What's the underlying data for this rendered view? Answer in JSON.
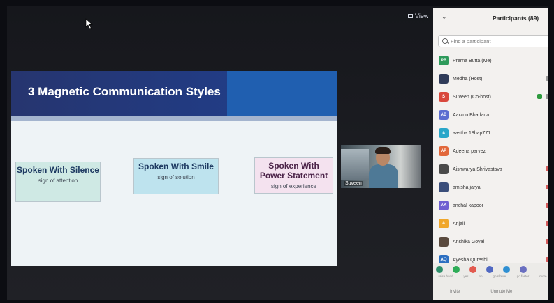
{
  "toolbar": {
    "view_label": "View"
  },
  "slide": {
    "title": "3 Magnetic Communication Styles",
    "cards": [
      {
        "heading": "Spoken With Silence",
        "subtitle": "sign of attention",
        "color": "#cfe9e4"
      },
      {
        "heading": "Spoken With Smile",
        "subtitle": "sign of solution",
        "color": "#bee3ee"
      },
      {
        "heading": "Spoken With Power Statement",
        "subtitle": "sign of experience",
        "color": "#f4e2ef"
      }
    ]
  },
  "video": {
    "name": "Suveen"
  },
  "participants": {
    "title": "Participants (89)",
    "search_placeholder": "Find a participant",
    "list": [
      {
        "initials": "PB",
        "name": "Prerna Butta (Me)",
        "color": "#2e9a5b"
      },
      {
        "initials": "",
        "name": "Medha (Host)",
        "color": "#2f3b59"
      },
      {
        "initials": "S",
        "name": "Suveen (Co-host)",
        "color": "#d9473c"
      },
      {
        "initials": "AB",
        "name": "Aarzoo Bhadana",
        "color": "#5d6ed0"
      },
      {
        "initials": "a",
        "name": "aastha 18bap771",
        "color": "#2aa6c9"
      },
      {
        "initials": "AP",
        "name": "Adeena parvez",
        "color": "#e2683b"
      },
      {
        "initials": "",
        "name": "Aishwarya Shrivastava",
        "color": "#4a4a4a"
      },
      {
        "initials": "",
        "name": "amisha jaryal",
        "color": "#3b4e7a"
      },
      {
        "initials": "AK",
        "name": "anchal kapoor",
        "color": "#6f5fd1"
      },
      {
        "initials": "A",
        "name": "Anjali",
        "color": "#f0a72b"
      },
      {
        "initials": "",
        "name": "Anshika Goyal",
        "color": "#5a4a3e"
      },
      {
        "initials": "AQ",
        "name": "Ayesha Qureshi",
        "color": "#2c6fc1"
      }
    ],
    "reactions": [
      {
        "label": "raise hand",
        "color": "#2d8e6a"
      },
      {
        "label": "yes",
        "color": "#2eac57"
      },
      {
        "label": "no",
        "color": "#e25a4f"
      },
      {
        "label": "go slower",
        "color": "#5068c2"
      },
      {
        "label": "go faster",
        "color": "#2e8fd2"
      },
      {
        "label": "more",
        "color": "#6a6fc0"
      }
    ],
    "invite_label": "Invite",
    "unmute_label": "Unmute Me"
  }
}
